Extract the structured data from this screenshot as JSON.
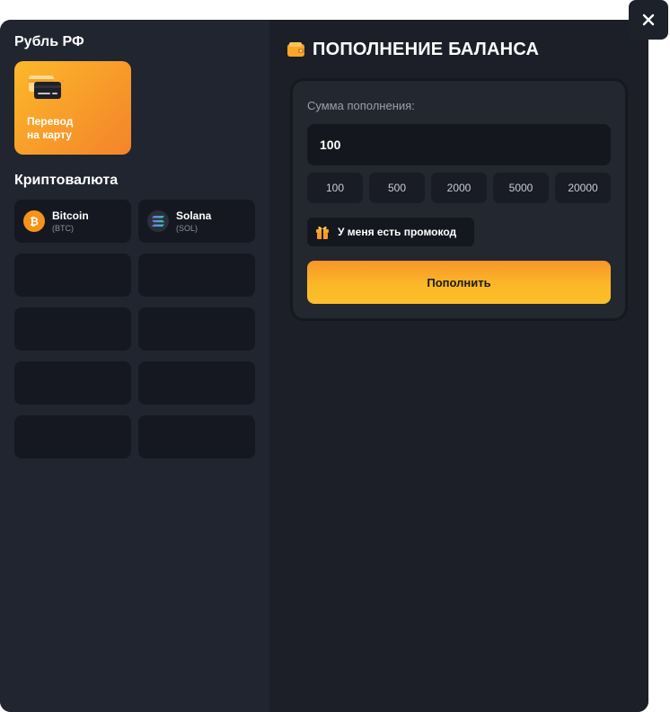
{
  "close_button": {
    "icon": "close-icon",
    "glyph": "✕"
  },
  "left": {
    "ruble_title": "Рубль РФ",
    "card_transfer": {
      "label": "Перевод\nна карту",
      "icon": "card-icon"
    },
    "crypto_title": "Криптовалюта",
    "crypto": [
      {
        "name": "Bitcoin",
        "ticker": "(BTC)",
        "icon": "bitcoin-icon",
        "color": "#f7931a"
      },
      {
        "name": "Solana",
        "ticker": "(SOL)",
        "icon": "solana-icon",
        "color": "#2a2f3b"
      }
    ]
  },
  "right": {
    "title": "ПОПОЛНЕНИЕ БАЛАНСА",
    "title_icon": "wallet-icon",
    "amount_label": "Сумма пополнения:",
    "amount_value": "100",
    "presets": [
      "100",
      "500",
      "2000",
      "5000",
      "20000"
    ],
    "promo_label": "У меня есть промокод",
    "promo_icon": "gift-icon",
    "submit_label": "Пополнить"
  },
  "colors": {
    "accent": "#f9a62a",
    "modal_bg": "#1e222b",
    "tile_bg": "#151820"
  }
}
